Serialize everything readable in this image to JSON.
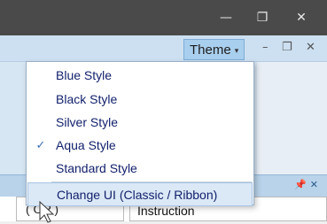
{
  "titlebar": {
    "minimize_icon": "minimize-icon",
    "restore_icon": "restore-icon",
    "close_icon": "close-icon"
  },
  "ribbon": {
    "theme_label": "Theme",
    "caret": "▾"
  },
  "menu": {
    "items": [
      {
        "label": "Blue Style",
        "checked": false
      },
      {
        "label": "Black Style",
        "checked": false
      },
      {
        "label": "Silver Style",
        "checked": false
      },
      {
        "label": "Aqua Style",
        "checked": true
      },
      {
        "label": "Standard Style",
        "checked": false
      },
      {
        "label": "Change UI (Classic / Ribbon)",
        "checked": false
      }
    ],
    "check_glyph": "✓"
  },
  "panel": {
    "left_cell": "( OP )",
    "right_cell": "Instruction"
  },
  "colors": {
    "accent": "#a9cfee",
    "menu_text": "#101f6b"
  }
}
